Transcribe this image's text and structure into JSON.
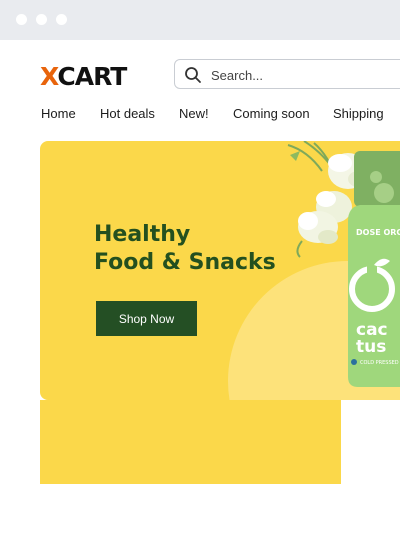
{
  "window": {
    "controls": [
      "close",
      "minimize",
      "maximize"
    ]
  },
  "header": {
    "logo": {
      "accent_letter": "X",
      "rest": "CART"
    },
    "search": {
      "placeholder": "Search...",
      "icon": "search-icon"
    }
  },
  "nav": {
    "items": [
      {
        "label": "Home"
      },
      {
        "label": "Hot deals"
      },
      {
        "label": "New!"
      },
      {
        "label": "Coming soon"
      },
      {
        "label": "Shipping"
      }
    ]
  },
  "hero": {
    "headline_line1": "Healthy",
    "headline_line2": "Food & Snacks",
    "cta_label": "Shop Now",
    "product": {
      "brand": "DOSE ORGANIC",
      "name_line1": "cac",
      "name_line2": "tus",
      "tagline": "COLD PRESSED"
    }
  },
  "colors": {
    "banner_yellow": "#fbd84a",
    "headline_green": "#24501f",
    "button_green": "#244f24",
    "logo_accent": "#e8640c",
    "bottle_green": "#9fd77c"
  }
}
